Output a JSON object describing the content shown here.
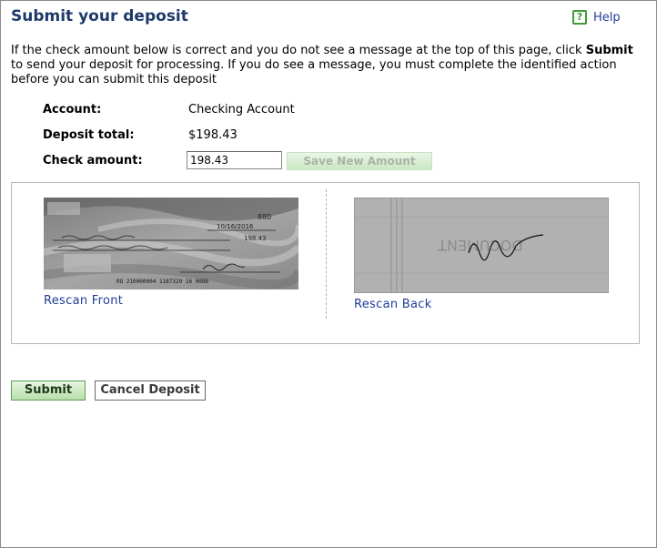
{
  "page": {
    "title": "Submit your deposit",
    "help_label": "Help"
  },
  "intro": {
    "text_before": "If the check amount below is correct and you do not see a message at the top of this page, click ",
    "bold": "Submit",
    "text_after": " to send your deposit for processing. If you do see a message, you must complete the identified action before you can submit this deposit"
  },
  "fields": {
    "account_label": "Account:",
    "account_value": "Checking Account",
    "deposit_total_label": "Deposit total:",
    "deposit_total_value": "$198.43",
    "check_amount_label": "Check amount:",
    "check_amount_value": "198.43"
  },
  "buttons": {
    "save_new_amount": "Save New Amount",
    "submit": "Submit",
    "cancel_deposit": "Cancel Deposit"
  },
  "check_images": {
    "rescan_front": "Rescan Front",
    "rescan_back": "Rescan Back",
    "front_number": "880",
    "front_amount": "198.43",
    "front_date": "10/16/2016",
    "front_micr": "RO 210000004 1187329 16 0086",
    "back_endorsement": "DOCUMENT"
  },
  "colors": {
    "title": "#1d3a6a",
    "link": "#1f3d96",
    "accent_green": "#3f9a38"
  }
}
